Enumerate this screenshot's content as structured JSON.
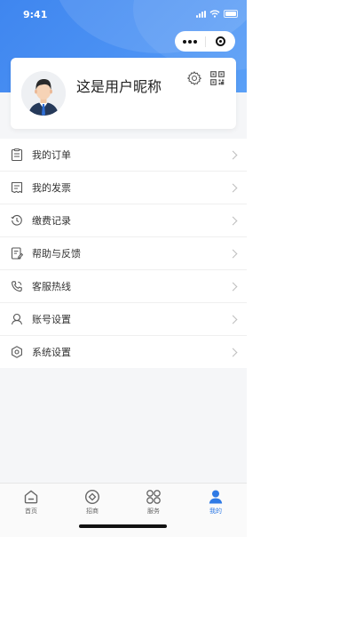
{
  "status_bar": {
    "time": "9:41"
  },
  "profile": {
    "nickname": "这是用户昵称"
  },
  "menu": {
    "items": [
      {
        "label": "我的订单",
        "icon": "order-icon"
      },
      {
        "label": "我的发票",
        "icon": "invoice-icon"
      },
      {
        "label": "缴费记录",
        "icon": "payment-history-icon"
      },
      {
        "label": "帮助与反馈",
        "icon": "help-feedback-icon"
      },
      {
        "label": "客服热线",
        "icon": "hotline-icon"
      },
      {
        "label": "账号设置",
        "icon": "account-icon"
      },
      {
        "label": "系统设置",
        "icon": "system-settings-icon"
      }
    ]
  },
  "tabbar": {
    "tabs": [
      {
        "label": "首页",
        "icon": "home-icon"
      },
      {
        "label": "招商",
        "icon": "investment-icon"
      },
      {
        "label": "服务",
        "icon": "service-icon"
      },
      {
        "label": "我的",
        "icon": "profile-icon"
      }
    ],
    "active_index": 3
  },
  "colors": {
    "primary": "#3f86ef",
    "active_tab": "#2f7ae5",
    "text": "#333333",
    "background": "#f5f6f8"
  }
}
